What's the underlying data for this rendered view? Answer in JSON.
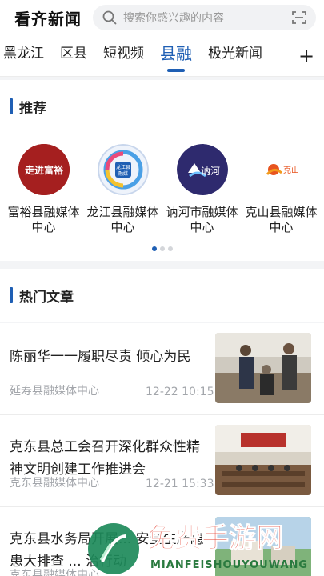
{
  "header": {
    "app_title": "看齐新闻",
    "search_placeholder": "搜索你感兴趣的内容",
    "search_icon": "search-icon",
    "scan_icon": "scan-icon"
  },
  "tabs": [
    {
      "label": "黑龙江",
      "active": false
    },
    {
      "label": "区县",
      "active": false
    },
    {
      "label": "短视频",
      "active": false
    },
    {
      "label": "县融",
      "active": true
    },
    {
      "label": "极光新闻",
      "active": false
    }
  ],
  "tabs_add_icon": "+",
  "recommend": {
    "title": "推荐",
    "items": [
      {
        "name": "富裕县融媒体中心",
        "logo_text": "走进富裕"
      },
      {
        "name": "龙江县融媒体中心",
        "logo_text": "龙江县融媒"
      },
      {
        "name": "讷河市融媒体中心",
        "logo_text": "讷河"
      },
      {
        "name": "克山县融媒体中心",
        "logo_text": "克山"
      }
    ],
    "page_count": 3,
    "current_page": 1
  },
  "hot": {
    "title": "热门文章",
    "articles": [
      {
        "title": "陈丽华一一履职尽责 倾心为民",
        "source": "延寿县融媒体中心",
        "time": "12-22 10:15"
      },
      {
        "title": "克东县总工会召开深化群众性精神文明创建工作推进会",
        "source": "克东县融媒体中心",
        "time": "12-21 15:33"
      },
      {
        "title": "克东县水务局开展... 安全生产隐患大排查 ... 治行动",
        "source": "克东县融媒体中心",
        "time": ""
      }
    ]
  },
  "watermark": {
    "text": "免费手游网",
    "subtext": "MIANFEISHOUYOUWANG"
  },
  "colors": {
    "accent": "#1f5fb4",
    "muted": "#a3a6ab"
  }
}
